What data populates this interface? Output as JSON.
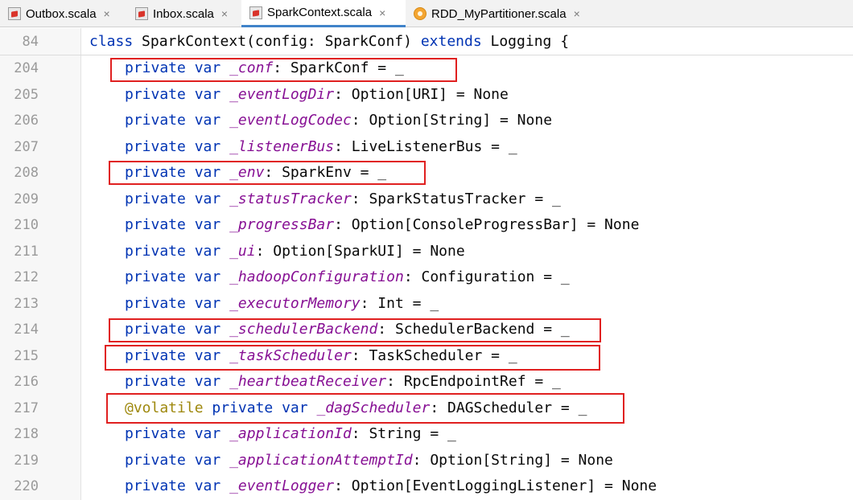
{
  "tabs": [
    {
      "label": "Outbox.scala",
      "icon": "scala-file-icon",
      "active": false
    },
    {
      "label": "Inbox.scala",
      "icon": "scala-file-icon",
      "active": false
    },
    {
      "label": "SparkContext.scala",
      "icon": "scala-file-icon",
      "active": true
    },
    {
      "label": "RDD_MyPartitioner.scala",
      "icon": "scala-object-icon",
      "active": false
    }
  ],
  "close_glyph": "×",
  "sticky": {
    "line_no": "84",
    "kw_class": "class",
    "rest1": " SparkContext(config: SparkConf) ",
    "kw_extends": "extends",
    "rest2": " Logging {"
  },
  "keywords": {
    "private": "private",
    "var": "var",
    "volatile": "@volatile"
  },
  "lines": [
    {
      "no": "204",
      "field": "_conf",
      "rest": ": SparkConf = _"
    },
    {
      "no": "205",
      "field": "_eventLogDir",
      "rest": ": Option[URI] = None"
    },
    {
      "no": "206",
      "field": "_eventLogCodec",
      "rest": ": Option[String] = None"
    },
    {
      "no": "207",
      "field": "_listenerBus",
      "rest": ": LiveListenerBus = _"
    },
    {
      "no": "208",
      "field": "_env",
      "rest": ": SparkEnv = _"
    },
    {
      "no": "209",
      "field": "_statusTracker",
      "rest": ": SparkStatusTracker = _"
    },
    {
      "no": "210",
      "field": "_progressBar",
      "rest": ": Option[ConsoleProgressBar] = None"
    },
    {
      "no": "211",
      "field": "_ui",
      "rest": ": Option[SparkUI] = None"
    },
    {
      "no": "212",
      "field": "_hadoopConfiguration",
      "rest": ": Configuration = _"
    },
    {
      "no": "213",
      "field": "_executorMemory",
      "rest": ": Int = _"
    },
    {
      "no": "214",
      "field": "_schedulerBackend",
      "rest": ": SchedulerBackend = _"
    },
    {
      "no": "215",
      "field": "_taskScheduler",
      "rest": ": TaskScheduler = _"
    },
    {
      "no": "216",
      "field": "_heartbeatReceiver",
      "rest": ": RpcEndpointRef = _"
    },
    {
      "no": "217",
      "field": "_dagScheduler",
      "rest": ": DAGScheduler = _"
    },
    {
      "no": "218",
      "field": "_applicationId",
      "rest": ": String = _"
    },
    {
      "no": "219",
      "field": "_applicationAttemptId",
      "rest": ": Option[String] = None"
    },
    {
      "no": "220",
      "field": "_eventLogger",
      "rest": ": Option[EventLoggingListener] = None"
    }
  ],
  "highlight_color": "#e02020"
}
